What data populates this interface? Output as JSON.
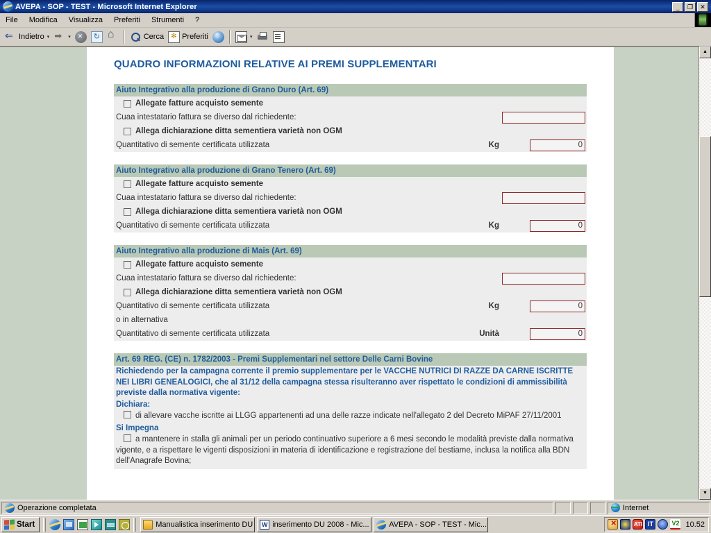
{
  "window": {
    "title": "AVEPA - SOP - TEST - Microsoft Internet Explorer",
    "minimize_label": "_",
    "maximize_label": "❐",
    "close_label": "✕"
  },
  "menubar": {
    "items": [
      {
        "label": "File"
      },
      {
        "label": "Modifica"
      },
      {
        "label": "Visualizza"
      },
      {
        "label": "Preferiti"
      },
      {
        "label": "Strumenti"
      },
      {
        "label": "?"
      }
    ]
  },
  "toolbar": {
    "back_label": "Indietro",
    "search_label": "Cerca",
    "favorites_label": "Preferiti",
    "caret": "▾"
  },
  "page": {
    "title": "QUADRO INFORMAZIONI RELATIVE AI PREMI SUPPLEMENTARI",
    "sections": [
      {
        "header": "Aiuto Integrativo alla produzione di Grano Duro (Art. 69)",
        "rows": [
          {
            "kind": "checkbox",
            "label": "Allegate fatture acquisto semente"
          },
          {
            "kind": "text-input",
            "label": "Cuaa intestatario fattura se diverso dal richiedente:",
            "value": ""
          },
          {
            "kind": "checkbox",
            "label": "Allega dichiarazione ditta sementiera varietà non OGM"
          },
          {
            "kind": "num-input",
            "label": "Quantitativo di semente certificata utilizzata",
            "unit": "Kg",
            "value": "0"
          }
        ]
      },
      {
        "header": "Aiuto Integrativo alla produzione di Grano Tenero (Art. 69)",
        "rows": [
          {
            "kind": "checkbox",
            "label": "Allegate fatture acquisto semente"
          },
          {
            "kind": "text-input",
            "label": "Cuaa intestatario fattura se diverso dal richiedente:",
            "value": ""
          },
          {
            "kind": "checkbox",
            "label": "Allega dichiarazione ditta sementiera varietà non OGM"
          },
          {
            "kind": "num-input",
            "label": "Quantitativo di semente certificata utilizzata",
            "unit": "Kg",
            "value": "0"
          }
        ]
      },
      {
        "header": "Aiuto Integrativo alla produzione di Mais (Art. 69)",
        "rows": [
          {
            "kind": "checkbox",
            "label": "Allegate fatture acquisto semente"
          },
          {
            "kind": "text-input",
            "label": "Cuaa intestatario fattura se diverso dal richiedente:",
            "value": ""
          },
          {
            "kind": "checkbox",
            "label": "Allega dichiarazione ditta sementiera varietà non OGM"
          },
          {
            "kind": "num-input",
            "label": "Quantitativo di semente certificata utilizzata",
            "unit": "Kg",
            "value": "0"
          },
          {
            "kind": "plain",
            "label": "o in alternativa"
          },
          {
            "kind": "num-input",
            "label": "Quantitativo di semente certificata utilizzata",
            "unit": "Unità",
            "value": "0"
          }
        ]
      }
    ],
    "bovine": {
      "header": "Art. 69 REG. (CE) n. 1782/2003 - Premi Supplementari nel settore Delle Carni Bovine",
      "intro": "Richiedendo per la campagna corrente il premio supplementare per le VACCHE NUTRICI DI RAZZE DA CARNE ISCRITTE NEI LIBRI GENEALOGICI, che al 31/12 della campagna stessa risulteranno aver rispettato le condizioni di ammissibilità previste dalla normativa vigente:",
      "dichiara_label": "Dichiara:",
      "dichiara_text": "di allevare vacche iscritte ai LLGG appartenenti ad una delle razze indicate nell'allegato 2 del Decreto MiPAF 27/11/2001",
      "impegna_label": "Si Impegna",
      "impegna_text": "a mantenere in stalla gli animali per un periodo continuativo superiore a 6 mesi secondo le modalità previste dalla normativa vigente, e a rispettare le vigenti disposizioni in materia di identificazione e registrazione del bestiame, inclusa la notifica alla BDN dell'Anagrafe Bovina;"
    }
  },
  "scrollbar": {
    "up_arrow": "▲",
    "down_arrow": "▼"
  },
  "statusbar": {
    "message": "Operazione completata",
    "zone": "Internet"
  },
  "taskbar": {
    "start_label": "Start",
    "tasks": [
      {
        "label": "Manualistica inserimento DU",
        "icon": "folder-icon"
      },
      {
        "label": "inserimento DU 2008 - Mic...",
        "icon": "word-icon"
      },
      {
        "label": "AVEPA - SOP - TEST - Mic...",
        "icon": "ie-icon"
      }
    ],
    "tray": {
      "locale": "IT",
      "v2": "V2",
      "ati": "ATI",
      "clock": "10.52"
    }
  },
  "colors": {
    "title_bar": "#0a246a",
    "section_header_bg": "#b9c9b5",
    "heading_blue": "#1f5c9e",
    "input_border": "#8c2626",
    "page_bg": "#c7d2c4",
    "row_bg": "#ededed"
  }
}
